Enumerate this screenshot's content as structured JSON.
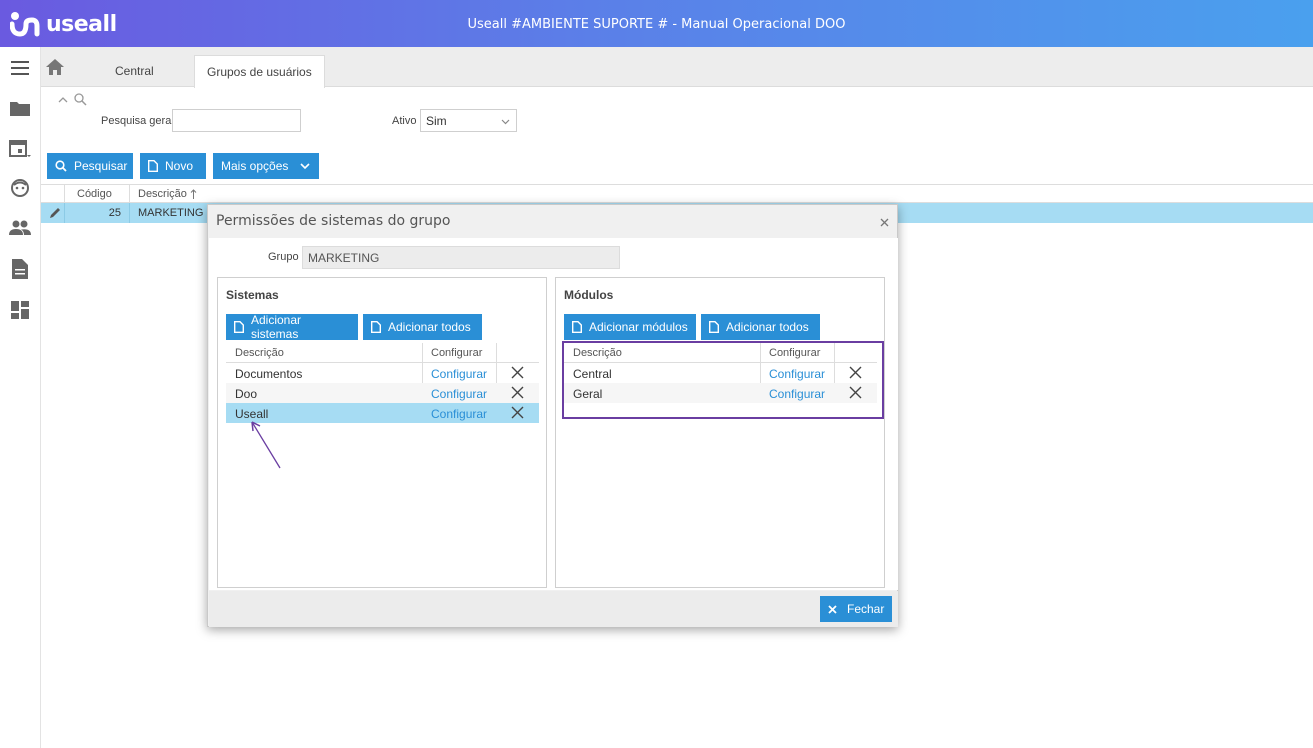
{
  "header": {
    "brand": "useall",
    "title": "Useall #AMBIENTE SUPORTE # - Manual Operacional DOO"
  },
  "sidebar": {
    "icons": [
      "menu-icon",
      "folder-icon",
      "calendar-icon",
      "face-icon",
      "people-icon",
      "document-icon",
      "dashboard-icon"
    ]
  },
  "tabs": [
    {
      "label": "Central"
    },
    {
      "label": "Grupos de usuários"
    }
  ],
  "filters": {
    "search_label": "Pesquisa geral",
    "search_value": "",
    "active_label": "Ativo",
    "active_value": "Sim"
  },
  "toolbar": {
    "search_label": "Pesquisar",
    "new_label": "Novo",
    "more_label": "Mais opções"
  },
  "grid": {
    "columns": [
      "Código",
      "Descrição"
    ],
    "rows": [
      {
        "code": "25",
        "description": "MARKETING"
      }
    ]
  },
  "modal": {
    "title": "Permissões de sistemas do grupo",
    "group_label": "Grupo",
    "group_value": "MARKETING",
    "systems": {
      "title": "Sistemas",
      "add_label": "Adicionar sistemas",
      "add_all_label": "Adicionar todos",
      "col_desc": "Descrição",
      "col_config": "Configurar",
      "rows": [
        {
          "desc": "Documentos",
          "config": "Configurar"
        },
        {
          "desc": "Doo",
          "config": "Configurar"
        },
        {
          "desc": "Useall",
          "config": "Configurar"
        }
      ]
    },
    "modules": {
      "title": "Módulos",
      "add_label": "Adicionar módulos",
      "add_all_label": "Adicionar todos",
      "col_desc": "Descrição",
      "col_config": "Configurar",
      "rows": [
        {
          "desc": "Central",
          "config": "Configurar"
        },
        {
          "desc": "Geral",
          "config": "Configurar"
        }
      ]
    },
    "close_label": "Fechar"
  },
  "colors": {
    "primary": "#2a8fd6",
    "selected_row": "#a6dcf3",
    "highlight_box": "#6a3ea1"
  }
}
